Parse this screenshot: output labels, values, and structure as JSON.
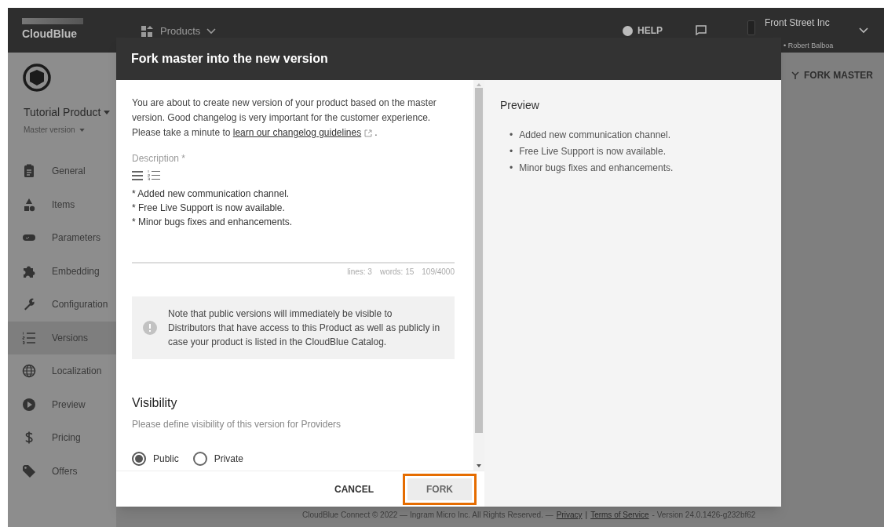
{
  "topbar": {
    "logo": "CloudBlue",
    "menu": "Products",
    "help": "HELP",
    "account": {
      "name": "Front Street Inc",
      "role": "• Robert Balboa"
    }
  },
  "sidebar": {
    "product": "Tutorial Product",
    "version": "Master version",
    "items": [
      {
        "label": "General",
        "selected": false
      },
      {
        "label": "Items",
        "selected": false
      },
      {
        "label": "Parameters",
        "selected": false
      },
      {
        "label": "Embedding",
        "selected": false
      },
      {
        "label": "Configuration",
        "selected": false
      },
      {
        "label": "Versions",
        "selected": true
      },
      {
        "label": "Localization",
        "selected": false
      },
      {
        "label": "Preview",
        "selected": false
      },
      {
        "label": "Pricing",
        "selected": false
      },
      {
        "label": "Offers",
        "selected": false
      }
    ]
  },
  "page": {
    "action": "FORK MASTER",
    "footer": {
      "text": "CloudBlue Connect © 2022 — Ingram Micro Inc. All Rights Reserved. —",
      "links": [
        "Privacy",
        "Terms of Service"
      ],
      "separator": "|",
      "version": "- Version 24.0.1426-g232bf62"
    }
  },
  "dialog": {
    "title": "Fork master into the new version",
    "intro": {
      "text": "You are about to create new version of your product based on the master version. Good changelog is very important for the customer experience. Please take a minute to",
      "link": "learn our changelog guidelines",
      "after": "."
    },
    "description": {
      "label": "Description *",
      "lines": [
        "* Added new communication channel.",
        "* Free Live Support is now available.",
        "* Minor bugs fixes and enhancements."
      ],
      "stats": [
        "lines: 3",
        "words: 15",
        "109/4000"
      ]
    },
    "note": "Note that public versions will immediately be visible to Distributors that have access to this Product as well as publicly in case your product is listed in the CloudBlue Catalog.",
    "visibility": {
      "title": "Visibility",
      "hint": "Please define visibility of this version for Providers",
      "options": [
        {
          "label": "Public",
          "selected": true
        },
        {
          "label": "Private",
          "selected": false
        }
      ]
    },
    "preview": {
      "title": "Preview",
      "marker": "•",
      "items": [
        "Added new communication channel.",
        "Free Live Support is now available.",
        "Minor bugs fixes and enhancements."
      ]
    },
    "buttons": [
      {
        "label": "CANCEL",
        "kind": "text",
        "highlighted": false
      },
      {
        "label": "FORK",
        "kind": "filled",
        "highlighted": true
      }
    ]
  }
}
